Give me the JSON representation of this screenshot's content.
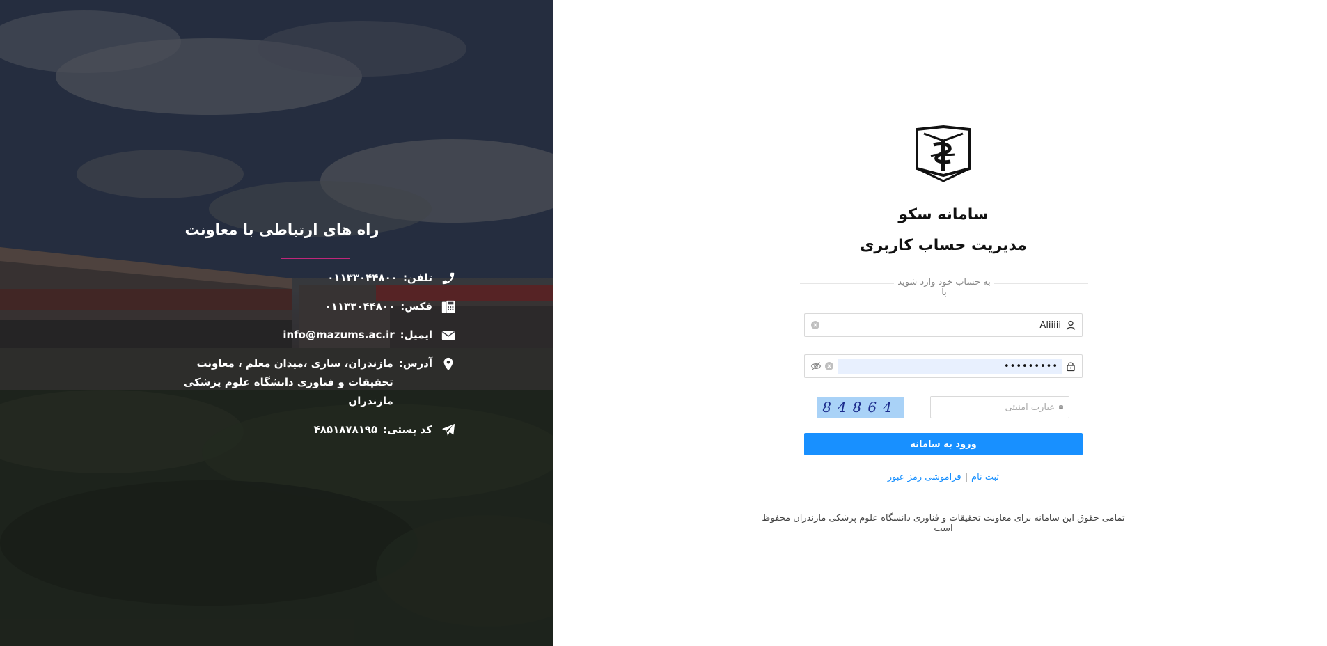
{
  "contact": {
    "title": "راه های ارتباطی با معاونت",
    "phone": {
      "label": "تلفن:",
      "value": "۰۱۱۳۳۰۴۴۸۰۰",
      "icon": "phone-icon"
    },
    "fax": {
      "label": "فکس:",
      "value": "۰۱۱۳۳۰۴۴۸۰۰",
      "icon": "fax-icon"
    },
    "email": {
      "label": "ایمیل:",
      "value": "info@mazums.ac.ir",
      "icon": "envelope-icon"
    },
    "address": {
      "label": "آدرس:",
      "value": "مازندران، ساری ،میدان معلم ، معاونت تحقیقات و فناوری دانشگاه علوم پزشکی مازندران",
      "icon": "map-pin-icon"
    },
    "postal": {
      "label": "کد پستی:",
      "value": "۴۸۵۱۸۷۸۱۹۵",
      "icon": "paper-plane-icon"
    }
  },
  "login": {
    "title": "سامانه سکو",
    "subtitle": "مدیریت حساب کاربری",
    "divider_text": "به حساب خود وارد شوید با",
    "username_value": "Aliiiii",
    "password_value": "•••••••••",
    "captcha_placeholder": "عبارت امنیتی",
    "captcha_code": "84864",
    "login_button": "ورود به سامانه",
    "register_link": "ثبت نام",
    "link_separator": "|",
    "forgot_link": "فراموشی رمز عبور",
    "copyright": "تمامی حقوق این سامانه برای معاونت تحقیقات و فناوری دانشگاه علوم پزشکی مازندران محفوظ است"
  },
  "colors": {
    "accent": "#1890ff",
    "title_underline": "#c0267a",
    "captcha_bg": "#a9d2f7"
  }
}
